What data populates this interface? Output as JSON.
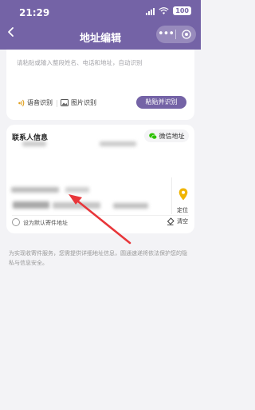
{
  "status": {
    "time": "21:29",
    "battery": "100"
  },
  "nav": {
    "title": "地址编辑",
    "more_label": "•••"
  },
  "paste": {
    "placeholder": "请粘贴或输入整段姓名、电话和地址，自动识别",
    "voice_label": "语音识别",
    "image_label": "图片识别",
    "paste_button": "粘贴并识别"
  },
  "contact": {
    "title": "联系人信息",
    "wechat_label": "微信地址",
    "locate_label": "定位",
    "default_label": "设为默认寄件地址",
    "clear_label": "清空"
  },
  "notice": "为实现收寄件服务，您需提供详细地址信息，圆通速递将依法保护您的隐私与信息安全。",
  "colors": {
    "brand": "#7463a6",
    "wechat_green": "#2dc100",
    "annotation_arrow": "#e8363a"
  }
}
